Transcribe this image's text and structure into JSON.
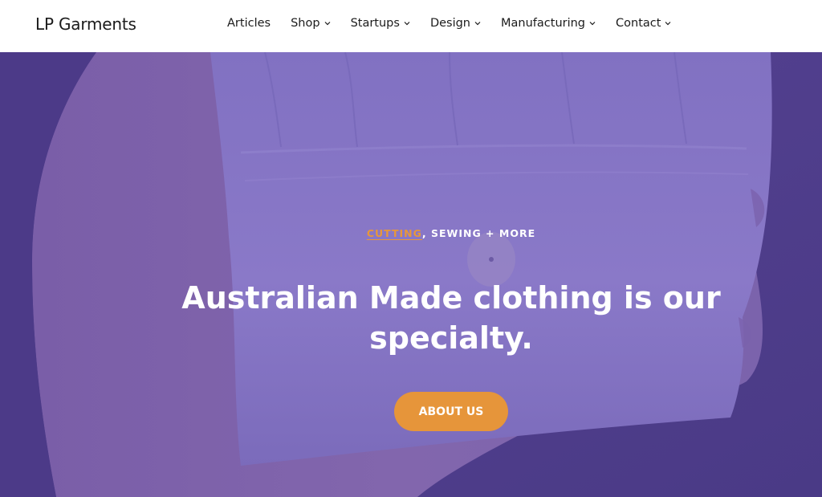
{
  "site": {
    "logo": "LP Garments"
  },
  "nav": {
    "items": [
      {
        "label": "Articles"
      },
      {
        "label": "Shop"
      },
      {
        "label": "Startups"
      },
      {
        "label": "Design"
      },
      {
        "label": "Manufacturing"
      },
      {
        "label": "Contact"
      }
    ]
  },
  "hero": {
    "eyebrow_link": "CUTTING",
    "eyebrow_rest": ", SEWING + MORE",
    "headline": "Australian Made clothing is our specialty.",
    "cta_label": "ABOUT US"
  },
  "colors": {
    "overlay": "#6a58b0",
    "accent": "#e6953a",
    "header_bg": "#ffffff",
    "text_dark": "#1b1b1b"
  }
}
